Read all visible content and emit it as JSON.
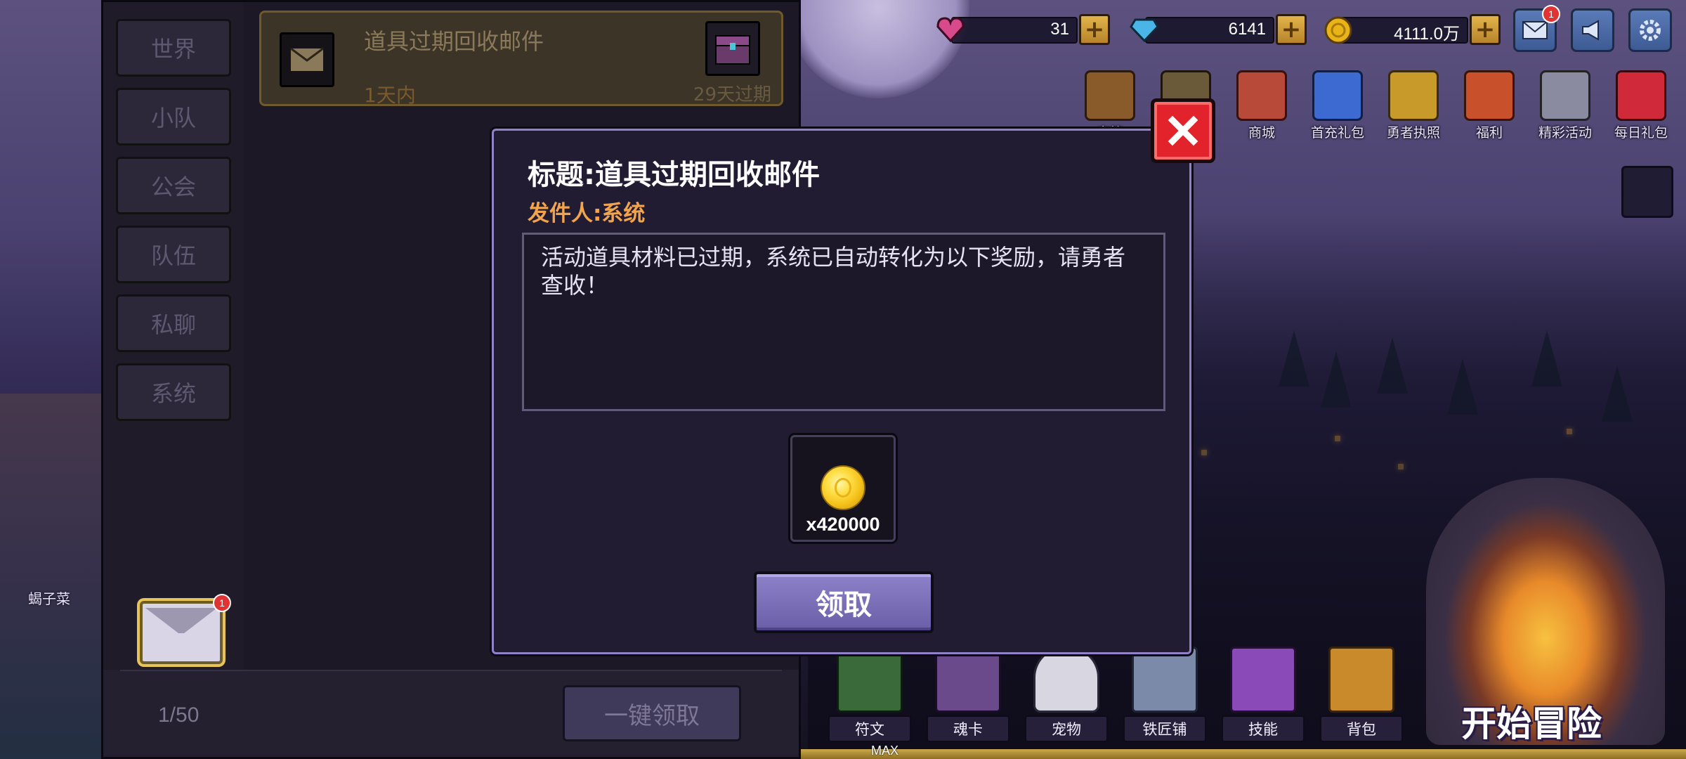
{
  "resources": [
    {
      "name": "ruby",
      "value": "31",
      "icon": "heart-gem-icon",
      "color": "#d84a8c"
    },
    {
      "name": "diamond",
      "value": "6141",
      "icon": "diamond-icon",
      "color": "#4ab6e8"
    },
    {
      "name": "gold",
      "value": "4111.0万",
      "icon": "gold-coin-icon",
      "color": "#e8b418"
    }
  ],
  "top_buttons": {
    "mail_badge": "1"
  },
  "activities": [
    {
      "label": "宝箱",
      "icon": "chest-icon"
    },
    {
      "label": "",
      "icon": "tv-icon"
    },
    {
      "label": "商城",
      "icon": "shop-icon"
    },
    {
      "label": "首充礼包",
      "icon": "first-recharge-icon"
    },
    {
      "label": "勇者执照",
      "icon": "license-icon"
    },
    {
      "label": "福利",
      "icon": "welfare-icon"
    },
    {
      "label": "精彩活动",
      "icon": "event-icon"
    },
    {
      "label": "每日礼包",
      "icon": "daily-gift-icon"
    }
  ],
  "bottom_nav": [
    {
      "label": "符文",
      "icon": "rune-icon"
    },
    {
      "label": "魂卡",
      "icon": "soul-card-icon"
    },
    {
      "label": "宠物",
      "icon": "pet-icon"
    },
    {
      "label": "铁匠铺",
      "icon": "blacksmith-icon"
    },
    {
      "label": "技能",
      "icon": "skill-icon"
    },
    {
      "label": "背包",
      "icon": "backpack-icon"
    }
  ],
  "max_label": "MAX",
  "start_adventure": "开始冒险",
  "player_name": "蝎子菜",
  "mail_panel": {
    "categories": [
      "世界",
      "小队",
      "公会",
      "队伍",
      "私聊",
      "系统"
    ],
    "mail": {
      "title": "道具过期回收邮件",
      "time": "1天内",
      "expire": "29天过期"
    },
    "count": "1/50",
    "claim_all": "一键领取",
    "mail_badge": "1"
  },
  "dialog": {
    "title": "标题:道具过期回收邮件",
    "sender": "发件人:系统",
    "body": "活动道具材料已过期，系统已自动转化为以下奖励，请勇者查收！",
    "reward": {
      "icon": "gold-coin-icon",
      "quantity": "x420000"
    },
    "claim": "领取"
  }
}
